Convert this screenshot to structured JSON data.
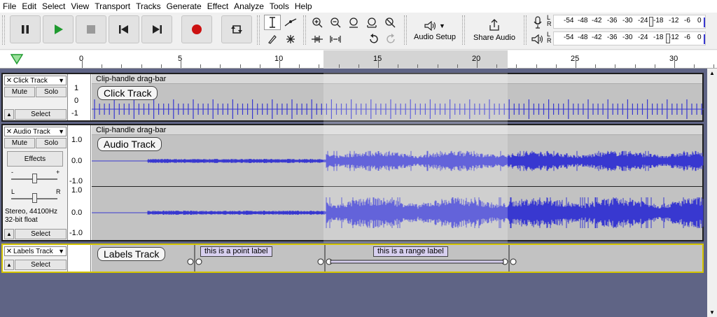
{
  "menu": [
    "File",
    "Edit",
    "Select",
    "View",
    "Transport",
    "Tracks",
    "Generate",
    "Effect",
    "Analyze",
    "Tools",
    "Help"
  ],
  "toolbar": {
    "audio_setup": "Audio Setup",
    "share_audio": "Share Audio",
    "meter_ticks": [
      "-54",
      "-48",
      "-42",
      "-36",
      "-30",
      "-24",
      "-18",
      "-12",
      "-6",
      "0"
    ],
    "record_meter_ticks": [
      "-54",
      "-48",
      "-42",
      "-36",
      "-30",
      "-24",
      "-18",
      "-12",
      "-6",
      "0"
    ],
    "meter_l": "L",
    "meter_r": "R",
    "colors": {
      "play": "#1f9a2f",
      "record": "#cc1111",
      "waveform": "#3838d0",
      "pause": "#222222"
    }
  },
  "ruler": {
    "labels": [
      "0",
      "5",
      "10",
      "15",
      "20",
      "25",
      "30"
    ]
  },
  "tracks": {
    "click": {
      "name": "Click Track",
      "mute": "Mute",
      "solo": "Solo",
      "select": "Select",
      "clip_bar": "Clip-handle drag-bar",
      "clip_name": "Click Track",
      "scale": [
        "1",
        "0",
        "-1"
      ]
    },
    "audio": {
      "name": "Audio Track",
      "mute": "Mute",
      "solo": "Solo",
      "effects": "Effects",
      "gain_minus": "-",
      "gain_plus": "+",
      "pan_l": "L",
      "pan_r": "R",
      "format_rate": "Stereo, 44100Hz",
      "format_bits": "32-bit float",
      "select": "Select",
      "clip_bar": "Clip-handle drag-bar",
      "clip_name": "Audio Track",
      "scale": [
        "1.0",
        "0.0",
        "-1.0"
      ]
    },
    "labels": {
      "name": "Labels Track",
      "select": "Select",
      "clip_name": "Labels Track",
      "point_label": "this is a point label",
      "range_label": "this is a range label"
    }
  }
}
